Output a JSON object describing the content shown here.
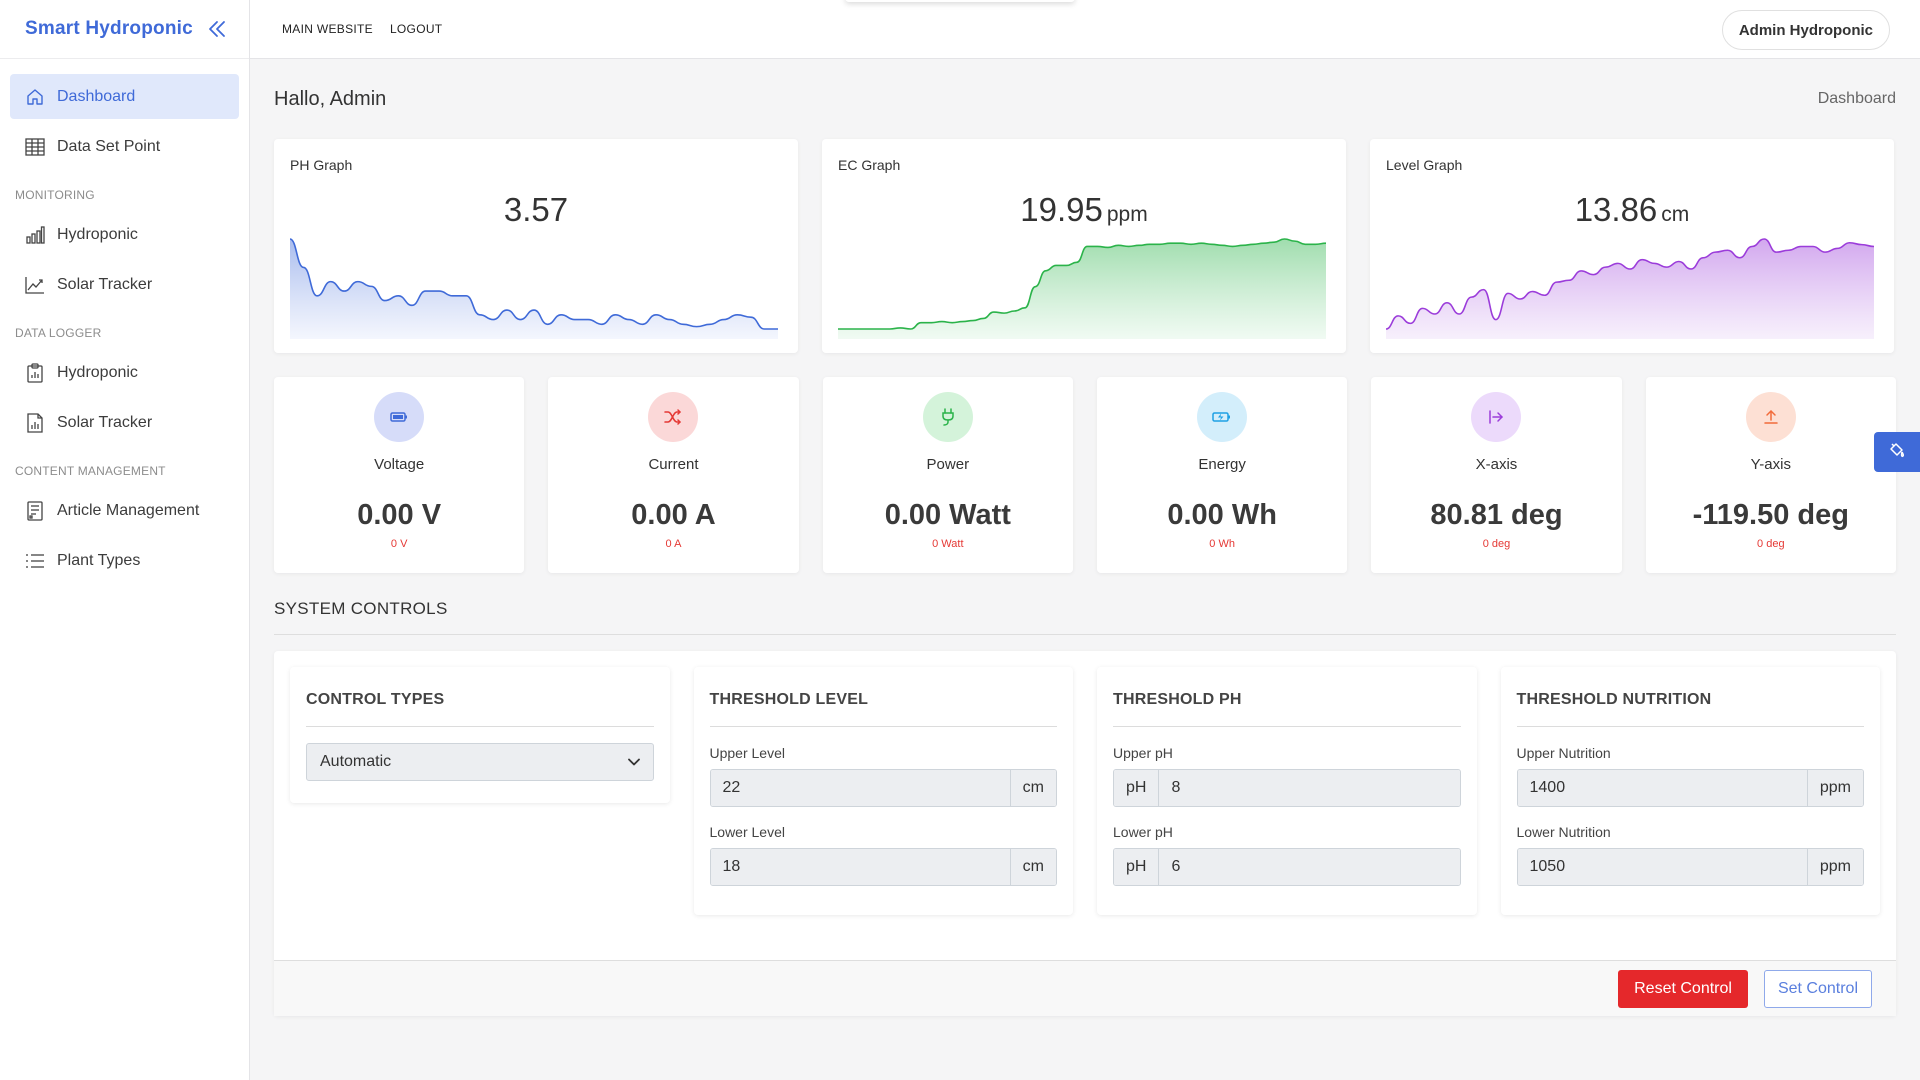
{
  "brand": {
    "name": "Smart Hydroponic",
    "toggle_icon": "double-chevron-left-icon"
  },
  "sidebar": {
    "items": [
      {
        "label": "Dashboard",
        "icon": "home-icon",
        "active": true
      },
      {
        "label": "Data Set Point",
        "icon": "table-icon"
      }
    ],
    "sections": [
      {
        "title": "MONITORING",
        "items": [
          {
            "label": "Hydroponic",
            "icon": "bar-chart-icon"
          },
          {
            "label": "Solar Tracker",
            "icon": "line-chart-icon"
          }
        ]
      },
      {
        "title": "DATA LOGGER",
        "items": [
          {
            "label": "Hydroponic",
            "icon": "clipboard-chart-icon"
          },
          {
            "label": "Solar Tracker",
            "icon": "document-chart-icon"
          }
        ]
      },
      {
        "title": "CONTENT MANAGEMENT",
        "items": [
          {
            "label": "Article Management",
            "icon": "article-icon"
          },
          {
            "label": "Plant Types",
            "icon": "list-icon"
          }
        ]
      }
    ]
  },
  "header": {
    "links": [
      "MAIN WEBSITE",
      "LOGOUT"
    ],
    "user": "Admin Hydroponic"
  },
  "page": {
    "greeting": "Hallo, Admin",
    "breadcrumb": "Dashboard"
  },
  "graphs": [
    {
      "title": "PH Graph",
      "value": "3.57",
      "unit": "",
      "color": "#3f6ad8",
      "fill": "#dfe6fb",
      "values": [
        4.8,
        4.2,
        3.6,
        3.9,
        3.7,
        3.9,
        3.8,
        3.5,
        3.6,
        3.4,
        3.7,
        3.7,
        3.6,
        3.6,
        3.2,
        3.1,
        3.3,
        3.1,
        3.3,
        3.0,
        3.2,
        3.1,
        3.1,
        3.0,
        3.2,
        3.1,
        3.0,
        3.2,
        3.1,
        3.0,
        2.95,
        3.0,
        3.1,
        3.2,
        3.15,
        2.9,
        2.9
      ]
    },
    {
      "title": "EC Graph",
      "value": "19.95",
      "unit": "ppm",
      "color": "#2bb34a",
      "fill": "#d6f2dc",
      "values": [
        11.0,
        11.0,
        11.0,
        11.0,
        11.0,
        11.0,
        11.1,
        11.0,
        11.6,
        11.6,
        11.7,
        11.6,
        11.7,
        11.8,
        12.0,
        12.6,
        12.5,
        12.7,
        13.0,
        15.0,
        16.5,
        17.0,
        17.0,
        17.3,
        18.8,
        18.8,
        18.7,
        18.9,
        18.8,
        18.9,
        19.0,
        19.0,
        19.1,
        19.1,
        19.0,
        19.1,
        19.0,
        18.9,
        18.8,
        18.9,
        19.0,
        19.1,
        19.2,
        19.5,
        19.3,
        19.0,
        19.0,
        19.1
      ]
    },
    {
      "title": "Level Graph",
      "value": "13.86",
      "unit": "cm",
      "color": "#9b3cda",
      "fill": "#e8d4f6",
      "values": [
        10.5,
        11.2,
        10.8,
        11.6,
        11.3,
        11.9,
        11.3,
        12.2,
        12.6,
        11.0,
        12.4,
        12.1,
        12.5,
        12.3,
        13.0,
        13.1,
        13.6,
        13.4,
        13.8,
        14.0,
        13.7,
        14.2,
        14.0,
        13.8,
        14.1,
        13.7,
        14.3,
        14.6,
        14.7,
        14.3,
        14.9,
        15.3,
        14.6,
        14.7,
        14.9,
        14.9,
        14.6,
        14.8,
        15.1,
        15.0,
        14.9
      ]
    }
  ],
  "metrics": [
    {
      "label": "Voltage",
      "value": "0.00 V",
      "sub": "0 V",
      "icon": "battery-icon",
      "bg": "#d6dcf9",
      "fg": "#3f6ad8"
    },
    {
      "label": "Current",
      "value": "0.00 A",
      "sub": "0 A",
      "icon": "shuffle-icon",
      "bg": "#fbd8d8",
      "fg": "#e53935"
    },
    {
      "label": "Power",
      "value": "0.00 Watt",
      "sub": "0 Watt",
      "icon": "plug-icon",
      "bg": "#d4f3da",
      "fg": "#2bb34a"
    },
    {
      "label": "Energy",
      "value": "0.00 Wh",
      "sub": "0 Wh",
      "icon": "battery-charging-icon",
      "bg": "#d3eefb",
      "fg": "#1ea0e4"
    },
    {
      "label": "X-axis",
      "value": "80.81 deg",
      "sub": "0 deg",
      "icon": "arrow-right-bar-icon",
      "bg": "#ecdafb",
      "fg": "#9b3cda"
    },
    {
      "label": "Y-axis",
      "value": "-119.50 deg",
      "sub": "0 deg",
      "icon": "arrow-up-bar-icon",
      "bg": "#fde0d4",
      "fg": "#f26b3a"
    }
  ],
  "controls": {
    "section_title": "SYSTEM CONTROLS",
    "control_types": {
      "title": "CONTROL TYPES",
      "selected": "Automatic"
    },
    "threshold_level": {
      "title": "THRESHOLD LEVEL",
      "upper_label": "Upper Level",
      "upper_value": "22",
      "lower_label": "Lower Level",
      "lower_value": "18",
      "unit": "cm"
    },
    "threshold_ph": {
      "title": "THRESHOLD PH",
      "upper_label": "Upper pH",
      "upper_value": "8",
      "lower_label": "Lower pH",
      "lower_value": "6",
      "prefix": "pH"
    },
    "threshold_nutrition": {
      "title": "THRESHOLD NUTRITION",
      "upper_label": "Upper Nutrition",
      "upper_value": "1400",
      "lower_label": "Lower Nutrition",
      "lower_value": "1050",
      "unit": "ppm"
    },
    "reset_label": "Reset Control",
    "set_label": "Set Control"
  }
}
